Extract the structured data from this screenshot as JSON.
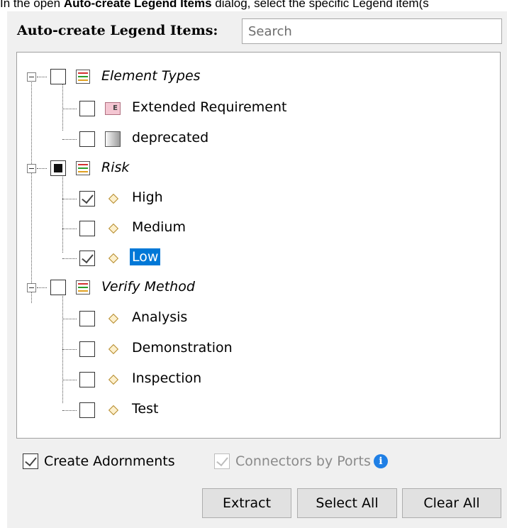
{
  "caption": {
    "prefix": "In the open ",
    "dialog_name": "Auto-create Legend Items",
    "suffix": " dialog, select the specific Legend item(s"
  },
  "header": {
    "label": "Auto-create Legend Items:",
    "search_placeholder": "Search"
  },
  "tree": {
    "element_types": {
      "label": "Element Types"
    },
    "extended_requirement": {
      "label": "Extended Requirement",
      "icon_letter": "E"
    },
    "deprecated": {
      "label": "deprecated"
    },
    "risk": {
      "label": "Risk"
    },
    "high": {
      "label": "High"
    },
    "medium": {
      "label": "Medium"
    },
    "low": {
      "label": "Low"
    },
    "verify_method": {
      "label": "Verify Method"
    },
    "analysis": {
      "label": "Analysis"
    },
    "demonstration": {
      "label": "Demonstration"
    },
    "inspection": {
      "label": "Inspection"
    },
    "test": {
      "label": "Test"
    }
  },
  "options": {
    "create_adornments": {
      "label": "Create Adornments",
      "checked": true
    },
    "connectors_by_ports": {
      "label": "Connectors by Ports",
      "checked": true,
      "enabled": false
    }
  },
  "buttons": {
    "extract": "Extract",
    "select_all": "Select All",
    "clear_all": "Clear All"
  },
  "colors": {
    "selection": "#0078d7",
    "info": "#1f7fe5",
    "requirement_icon": "#f4c6d2"
  }
}
